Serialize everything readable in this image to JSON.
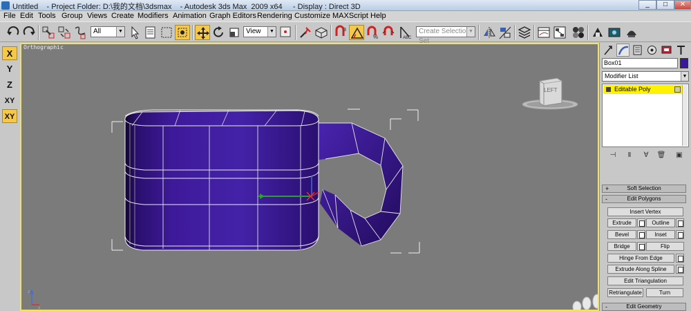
{
  "window": {
    "title": "Untitled    - Project Folder: D:\\我的文档\\3dsmax    - Autodesk 3ds Max  2009 x64     - Display : Direct 3D",
    "minimize": "_",
    "maximize": "□",
    "close": "✕"
  },
  "menu": [
    "File",
    "Edit",
    "Tools",
    "Group",
    "Views",
    "Create",
    "Modifiers",
    "Animation",
    "Graph Editors",
    "Rendering",
    "Customize",
    "MAXScript",
    "Help"
  ],
  "toolbar": {
    "selection_filter": "All",
    "ref_coord_system": "View",
    "selection_set_placeholder": "Create Selection Set"
  },
  "axis_constraints": [
    "X",
    "Y",
    "Z",
    "XY",
    "XY"
  ],
  "viewport": {
    "label": "Orthographic",
    "viewcube_face": "LEFT"
  },
  "command_panel": {
    "object_name": "Box01",
    "object_color": "#3b1a98",
    "modifier_list": "Modifier List",
    "stack_items": [
      "Editable Poly"
    ],
    "rollouts": {
      "soft_selection": "Soft Selection",
      "edit_polygons": "Edit Polygons",
      "edit_geometry": "Edit Geometry"
    },
    "buttons": {
      "insert_vertex": "Insert Vertex",
      "extrude": "Extrude",
      "outline": "Outline",
      "bevel": "Bevel",
      "inset": "Inset",
      "bridge": "Bridge",
      "flip": "Flip",
      "hinge_from_edge": "Hinge From Edge",
      "extrude_along_spline": "Extrude Along Spline",
      "edit_triangulation": "Edit Triangulation",
      "retriangulate": "Retriangulate",
      "turn": "Turn"
    }
  },
  "colors": {
    "viewport_bg": "#7b7b7b",
    "active_border": "#f3e25f",
    "mesh_purple": "#3a1592",
    "active_button": "#f5c84a"
  }
}
